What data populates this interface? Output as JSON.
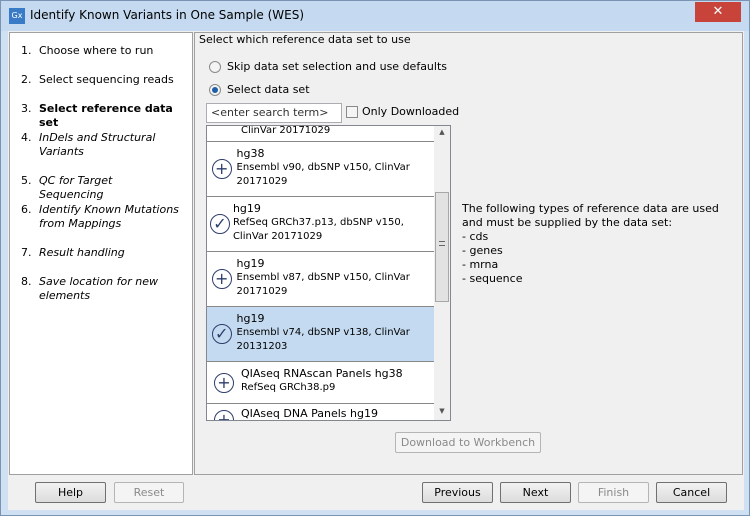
{
  "window": {
    "title": "Identify Known Variants in One Sample (WES)",
    "icon": "Gx"
  },
  "steps": [
    {
      "num": "1.",
      "label": "Choose where to run",
      "style": "normal"
    },
    {
      "num": "2.",
      "label": "Select sequencing reads",
      "style": "normal"
    },
    {
      "num": "3.",
      "label": "Select reference data set",
      "style": "current"
    },
    {
      "num": "4.",
      "label": "InDels and Structural Variants",
      "style": "italic"
    },
    {
      "num": "5.",
      "label": "QC for Target Sequencing",
      "style": "italic"
    },
    {
      "num": "6.",
      "label": "Identify Known Mutations from Mappings",
      "style": "italic"
    },
    {
      "num": "7.",
      "label": "Result handling",
      "style": "italic"
    },
    {
      "num": "8.",
      "label": "Save location for new elements",
      "style": "italic"
    }
  ],
  "main": {
    "heading": "Select which reference data set to use",
    "radio_skip": "Skip data set selection and use defaults",
    "radio_select": "Select data set",
    "selected_radio": "select",
    "search_placeholder": "<enter search term>",
    "only_downloaded": "Only Downloaded",
    "only_downloaded_checked": false,
    "list": [
      {
        "title": "",
        "desc": "ClinVar 20171029",
        "icon": "plus-circle"
      },
      {
        "title": "hg38",
        "desc": "Ensembl v90, dbSNP v150, ClinVar 20171029",
        "icon": "plus-circle"
      },
      {
        "title": "hg19",
        "desc": "RefSeq GRCh37.p13, dbSNP v150, ClinVar 20171029",
        "icon": "check-circle"
      },
      {
        "title": "hg19",
        "desc": "Ensembl v87, dbSNP v150, ClinVar 20171029",
        "icon": "plus-circle"
      },
      {
        "title": "hg19",
        "desc": "Ensembl v74, dbSNP v138, ClinVar 20131203",
        "icon": "check-circle",
        "selected": true
      },
      {
        "title": "QIAseq RNAscan Panels hg38",
        "desc": "RefSeq GRCh38.p9",
        "icon": "plus-circle"
      },
      {
        "title": "QIAseq DNA Panels hg19",
        "desc": "",
        "icon": "plus-circle"
      }
    ],
    "info_intro": "The following types of reference data are used and must be supplied by the data set:",
    "info_types": [
      "- cds",
      "- genes",
      "- mrna",
      "- sequence"
    ],
    "download_label": "Download to Workbench"
  },
  "buttons": {
    "help": "Help",
    "reset": "Reset",
    "previous": "Previous",
    "next": "Next",
    "finish": "Finish",
    "cancel": "Cancel"
  }
}
